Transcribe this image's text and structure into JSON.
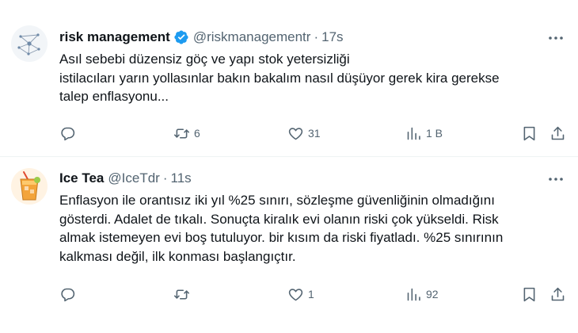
{
  "tweets": [
    {
      "display_name": "risk management",
      "verified": true,
      "handle": "@riskmanagementr",
      "separator": "·",
      "time": "17s",
      "avatar_icon": "network-logo-icon",
      "text_lines": [
        "Asıl sebebi düzensiz göç ve yapı stok yetersizliği",
        "istilacıları yarın yollasınlar bakın bakalım nasıl düşüyor gerek kira gerekse",
        "talep enflasyonu..."
      ],
      "stats": {
        "replies": "",
        "retweets": "6",
        "likes": "31",
        "views": "1 B"
      }
    },
    {
      "display_name": "Ice Tea",
      "verified": false,
      "handle": "@IceTdr",
      "separator": "·",
      "time": "11s",
      "avatar_icon": "iced-tea-glass-icon",
      "text_lines": [
        "Enflasyon ile orantısız iki yıl %25 sınırı, sözleşme güvenliğinin olmadığını",
        "gösterdi. Adalet de tıkalı. Sonuçta kiralık evi olanın riski çok yükseldi. Risk",
        "almak istemeyen evi boş tutuluyor. bir kısım da riski fiyatladı. %25 sınırının",
        "kalkması değil, ilk konması başlangıçtır."
      ],
      "stats": {
        "replies": "",
        "retweets": "",
        "likes": "1",
        "views": "92"
      }
    }
  ],
  "colors": {
    "text": "#0f1419",
    "muted": "#536471",
    "verified": "#1d9bf0",
    "divider": "#eff3f4"
  }
}
